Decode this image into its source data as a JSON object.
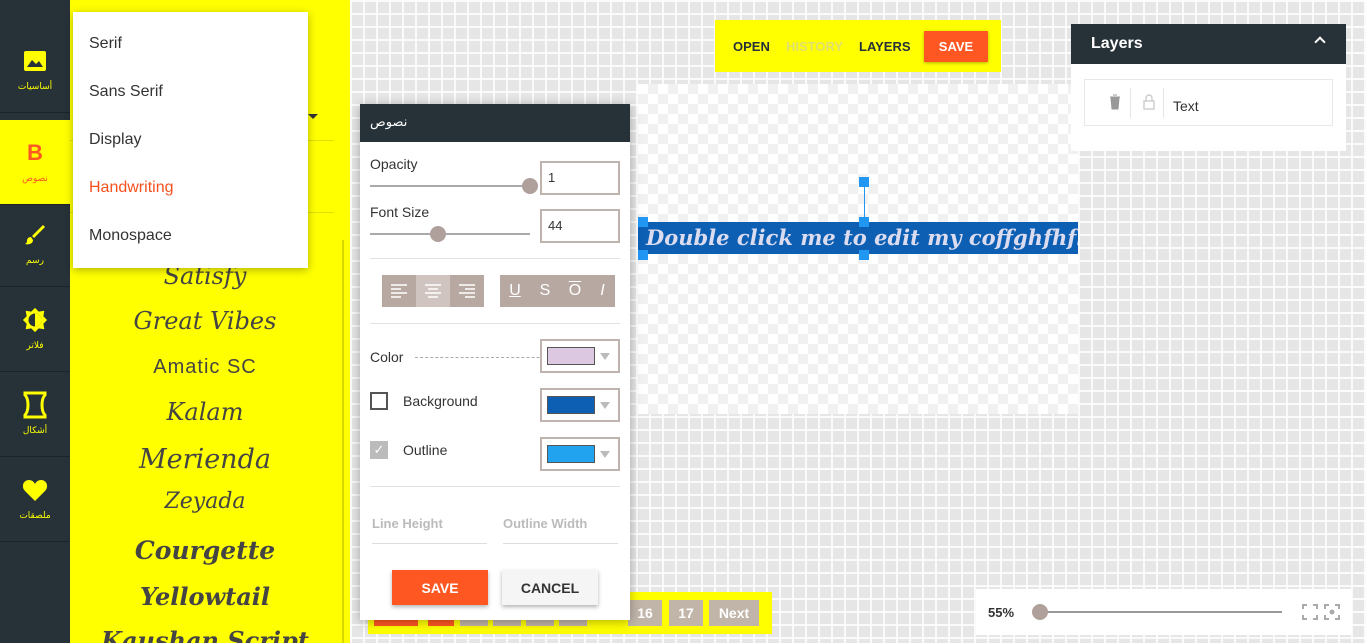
{
  "rail": {
    "items": [
      {
        "label": "أساسيات",
        "icon": "image-icon"
      },
      {
        "label": "نصوص",
        "icon": "bold-b-icon",
        "glyph": "B"
      },
      {
        "label": "رسم",
        "icon": "brush-icon"
      },
      {
        "label": "فلاتر",
        "icon": "brightness-icon"
      },
      {
        "label": "أشكال",
        "icon": "hourglass-shape-icon"
      },
      {
        "label": "ملصقات",
        "icon": "heart-icon"
      }
    ]
  },
  "font_menu": {
    "options": [
      "Serif",
      "Sans Serif",
      "Display",
      "Handwriting",
      "Monospace"
    ],
    "selected": "Handwriting"
  },
  "font_samples": [
    "Satisfy",
    "Great Vibes",
    "Amatic SC",
    "Kalam",
    "Merienda",
    "Zeyada",
    "Courgette",
    "Yellowtail",
    "Kaushan Script"
  ],
  "toolbar": {
    "open": "OPEN",
    "history": "HISTORY",
    "layers": "LAYERS",
    "save": "SAVE"
  },
  "canvas": {
    "text": "Double click me to edit my coffghfhfhftents."
  },
  "text_dialog": {
    "title": "نصوص",
    "opacity_label": "Opacity",
    "opacity_value": "1",
    "font_size_label": "Font Size",
    "font_size_value": "44",
    "format_buttons": [
      "U",
      "S",
      "O",
      "I"
    ],
    "color_label": "Color",
    "color_value": "#dcc8e0",
    "background_label": "Background",
    "background_checked": false,
    "background_color": "#0d5fb3",
    "outline_label": "Outline",
    "outline_checked": true,
    "outline_color": "#22a3f0",
    "line_height_placeholder": "Line Height",
    "outline_width_placeholder": "Outline Width",
    "save_label": "SAVE",
    "cancel_label": "CANCEL"
  },
  "pagination": {
    "pages": [
      "16",
      "17"
    ],
    "next": "Next"
  },
  "layers": {
    "title": "Layers",
    "items": [
      {
        "name": "Text"
      }
    ]
  },
  "zoom": {
    "value": "55%"
  }
}
